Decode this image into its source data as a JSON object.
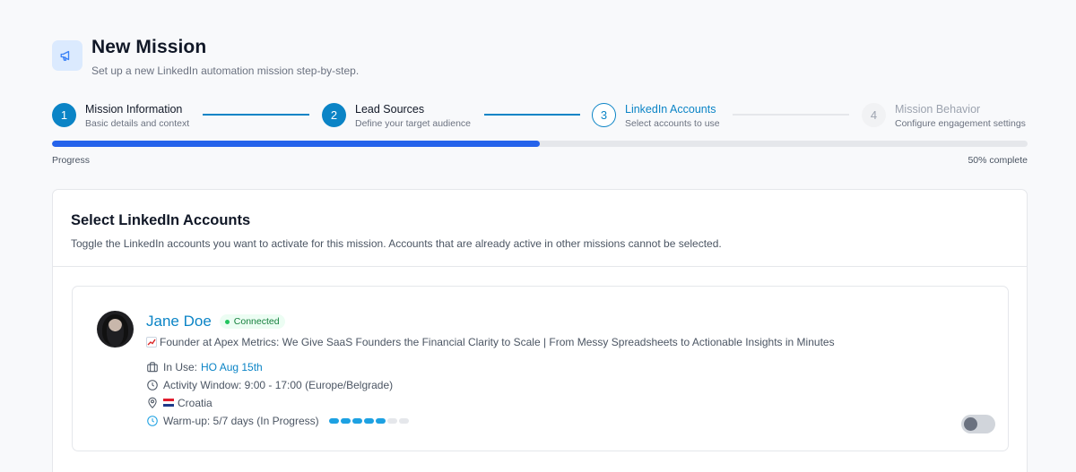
{
  "header": {
    "icon": "megaphone-icon",
    "title": "New Mission",
    "subtitle": "Set up a new LinkedIn automation mission step-by-step."
  },
  "steps": [
    {
      "number": "1",
      "title": "Mission Information",
      "description": "Basic details and context",
      "state": "done"
    },
    {
      "number": "2",
      "title": "Lead Sources",
      "description": "Define your target audience",
      "state": "done"
    },
    {
      "number": "3",
      "title": "LinkedIn Accounts",
      "description": "Select accounts to use",
      "state": "active"
    },
    {
      "number": "4",
      "title": "Mission Behavior",
      "description": "Configure engagement settings",
      "state": "todo"
    }
  ],
  "progress": {
    "label": "Progress",
    "value_percent": 50,
    "text": "50% complete"
  },
  "card": {
    "title": "Select LinkedIn Accounts",
    "subtitle": "Toggle the LinkedIn accounts you want to activate for this mission. Accounts that are already active in other missions cannot be selected."
  },
  "accounts": [
    {
      "name": "Jane Doe",
      "status": "Connected",
      "headline": "Founder at Apex Metrics: We Give SaaS Founders the Financial Clarity to Scale | From Messy Spreadsheets to Actionable Insights in Minutes",
      "headline_icon": "chart-increasing-emoji",
      "in_use_label": "In Use:",
      "in_use_value": "HO Aug 15th",
      "activity_window": "Activity Window: 9:00 - 17:00 (Europe/Belgrade)",
      "location": "Croatia",
      "location_flag": "croatia-flag-emoji",
      "warmup": "Warm-up: 5/7 days (In Progress)",
      "warmup_done": 5,
      "warmup_total": 7,
      "toggle_on": false
    }
  ],
  "colors": {
    "accent": "#0b84c6",
    "progress": "#2563eb",
    "connected": "#15803d",
    "warmup": "#1da1e2"
  }
}
